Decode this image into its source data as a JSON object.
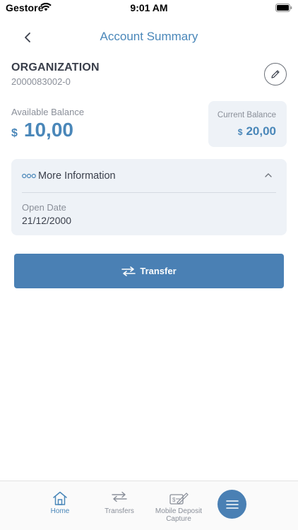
{
  "status_bar": {
    "carrier": "Gestore",
    "time": "9:01 AM"
  },
  "nav": {
    "title": "Account Summary"
  },
  "account": {
    "name": "ORGANIZATION",
    "number": "2000083002-0"
  },
  "balances": {
    "available_label": "Available Balance",
    "available_currency": "$",
    "available_amount": "10,00",
    "current_label": "Current Balance",
    "current_currency": "$",
    "current_amount": "20,00"
  },
  "more_info": {
    "title": "More Information",
    "open_date_label": "Open Date",
    "open_date_value": "21/12/2000"
  },
  "actions": {
    "transfer_label": "Transfer"
  },
  "tab_bar": {
    "home": "Home",
    "transfers": "Transfers",
    "mobile_deposit": "Mobile Deposit Capture"
  },
  "colors": {
    "accent": "#4a87b9",
    "button": "#4a80b4",
    "card_bg": "#eef2f7"
  },
  "icons": [
    "wifi-icon",
    "battery-icon",
    "chevron-left-icon",
    "pencil-icon",
    "dots-icon",
    "chevron-up-icon",
    "transfer-arrows-icon",
    "home-icon",
    "menu-icon"
  ]
}
